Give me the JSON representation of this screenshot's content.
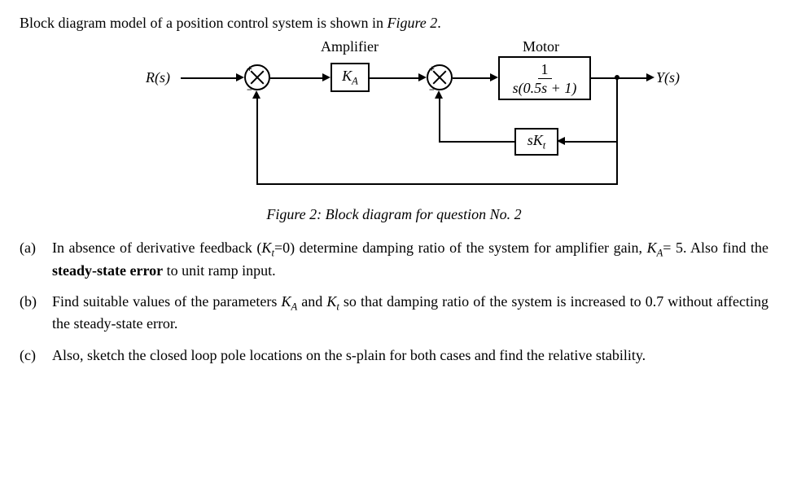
{
  "intro_pre": "Block diagram model of a position control system is shown in ",
  "intro_fig": "Figure 2",
  "intro_post": ".",
  "diagram": {
    "amplifier_label": "Amplifier",
    "motor_label": "Motor",
    "input": "R(s)",
    "output": "Y(s)",
    "amp_gain_prefix": "K",
    "amp_gain_sub": "A",
    "motor_num": "1",
    "motor_den": "s(0.5s + 1)",
    "deriv_prefix": "sK",
    "deriv_sub": "t",
    "sum1_top": "+",
    "sum1_bot": "−",
    "sum2_top": "+",
    "sum2_bot": "−"
  },
  "caption": "Figure 2: Block diagram for question No. 2",
  "qa": {
    "label": "(a)",
    "t1": "In absence of derivative feedback (",
    "kt": "K",
    "kt_sub": "t",
    "eq0": "=0) determine damping ratio of the system for amplifier gain, ",
    "ka": "K",
    "ka_sub": "A",
    "eq5": "= 5. Also find the ",
    "sse": "steady-state error",
    "tail": " to unit ramp input."
  },
  "qb": {
    "label": "(b)",
    "t1": "Find suitable values of the parameters ",
    "ka": "K",
    "ka_sub": "A",
    "and": " and ",
    "kt": "K",
    "kt_sub": "t",
    "t2": " so that damping ratio of the system is increased to 0.7 without affecting the steady-state error."
  },
  "qc": {
    "label": "(c)",
    "text": "Also, sketch the closed loop pole locations on the s-plain for both cases and find the relative stability."
  }
}
